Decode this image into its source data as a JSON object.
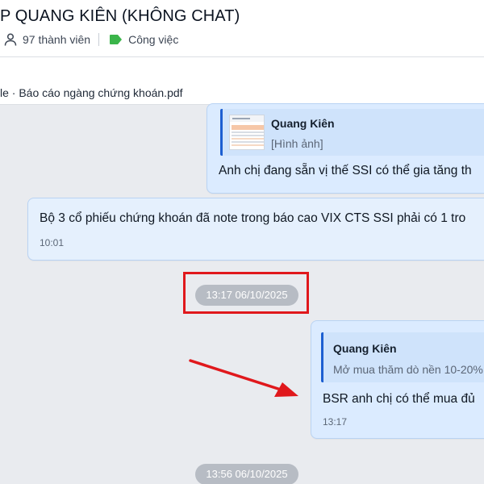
{
  "header": {
    "title": "P QUANG KIÊN (KHÔNG CHAT)",
    "members": "97 thành viên",
    "label": "Công việc",
    "label_color": "#3bb54a"
  },
  "pinned": {
    "text": "le · Báo cáo ngàng chứng khoán.pdf"
  },
  "messages": [
    {
      "type": "sent",
      "quote_name": "Quang Kiên",
      "quote_sub": "[Hình ảnh]",
      "text": "Anh chị đang sẵn vị thế SSI có thể gia tăng th"
    },
    {
      "type": "received",
      "text": "Bộ 3 cổ phiếu chứng khoán đã note trong báo cao VIX CTS SSI phải có 1 tro",
      "time": "10:01"
    },
    {
      "type": "sent",
      "quote_name": "Quang Kiên",
      "quote_sub": "Mở mua thăm dò nền 10-20%",
      "text": "BSR anh chị có thể mua đủ",
      "time": "13:17"
    }
  ],
  "date_separators": [
    "13:17 06/10/2025",
    "13:56 06/10/2025"
  ],
  "annotation_colors": {
    "highlight": "#e0181c",
    "arrow": "#e0181c"
  }
}
